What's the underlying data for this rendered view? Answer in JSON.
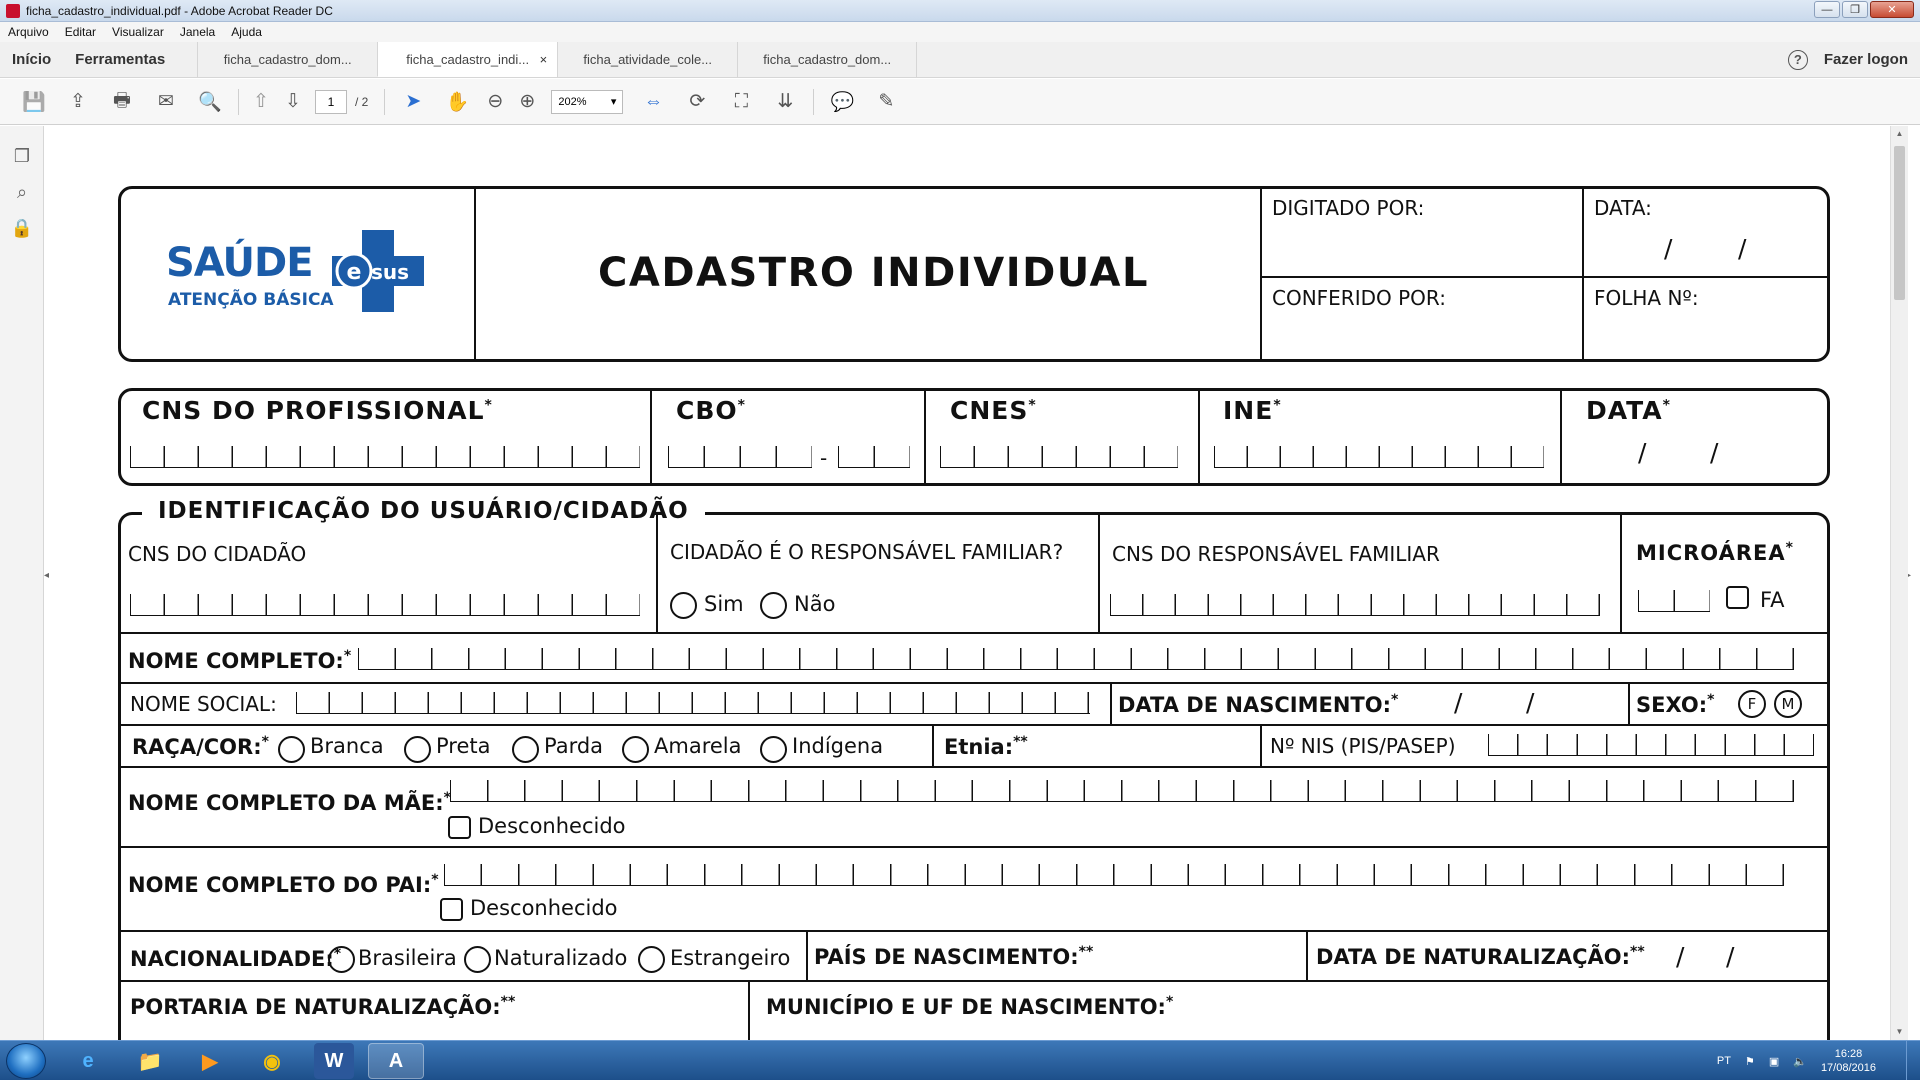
{
  "window": {
    "title": "ficha_cadastro_individual.pdf - Adobe Acrobat Reader DC",
    "minimize": "—",
    "restore": "❐",
    "close": "✕"
  },
  "menu": [
    "Arquivo",
    "Editar",
    "Visualizar",
    "Janela",
    "Ajuda"
  ],
  "tabs": {
    "home": "Início",
    "tools": "Ferramentas",
    "docs": [
      "ficha_cadastro_dom...",
      "ficha_cadastro_indi...",
      "ficha_atividade_cole...",
      "ficha_cadastro_dom..."
    ],
    "close_glyph": "×",
    "help": "?",
    "logon": "Fazer logon"
  },
  "toolbar": {
    "icons": {
      "save": "💾",
      "upload": "⇪",
      "print": "🖶",
      "mail": "✉",
      "search": "🔍",
      "prev": "⇧",
      "next": "⇩",
      "select": "➤",
      "hand": "✋",
      "zoomout": "⊖",
      "zoomin": "⊕",
      "fit": "⇔",
      "rotate": "⟳",
      "fullscreen": "⛶",
      "scroll": "⇊",
      "comment": "💬",
      "sign": "✎"
    },
    "page_current": "1",
    "page_total": "/ 2",
    "zoom": "202%",
    "zoom_arrow": "▾"
  },
  "rail": {
    "pages": "❐",
    "attach": "⌕",
    "security": "🔒",
    "collapse": "◂",
    "expand": "▸"
  },
  "form": {
    "logo_main": "SAÚDE",
    "logo_sus": "sus",
    "logo_sub": "ATENÇÃO BÁSICA",
    "title": "CADASTRO INDIVIDUAL",
    "digitado": "DIGITADO POR:",
    "data_top": "DATA:",
    "conferido": "CONFERIDO POR:",
    "folha": "FOLHA Nº:",
    "slash": "/",
    "star": "*",
    "star2": "**",
    "dash": "-",
    "cns_prof": "CNS DO PROFISSIONAL",
    "cbo": "CBO",
    "cnes": "CNES",
    "ine": "INE",
    "data": "DATA",
    "section": "IDENTIFICAÇÃO DO USUÁRIO/CIDADÃO",
    "cns_cidadao": "CNS DO CIDADÃO",
    "resp_familiar_q": "CIDADÃO É O RESPONSÁVEL FAMILIAR?",
    "sim": "Sim",
    "nao": "Não",
    "cns_resp": "CNS DO RESPONSÁVEL FAMILIAR",
    "microarea": "MICROÁREA",
    "fa": "FA",
    "nome_completo": "NOME COMPLETO:",
    "nome_social": "NOME SOCIAL:",
    "data_nasc": "DATA DE NASCIMENTO:",
    "sexo": "SEXO:",
    "sexo_f": "F",
    "sexo_m": "M",
    "raca": "RAÇA/COR:",
    "racas": [
      "Branca",
      "Preta",
      "Parda",
      "Amarela",
      "Indígena"
    ],
    "etnia": "Etnia:",
    "nis": "Nº NIS (PIS/PASEP)",
    "nome_mae": "NOME COMPLETO DA MÃE:",
    "nome_pai": "NOME COMPLETO DO PAI:",
    "desconhecido": "Desconhecido",
    "nacionalidade": "NACIONALIDADE:",
    "nacionalidades": [
      "Brasileira",
      "Naturalizado",
      "Estrangeiro"
    ],
    "pais_nasc": "PAÍS DE NASCIMENTO:",
    "data_nat": "DATA DE NATURALIZAÇÃO:",
    "portaria": "PORTARIA DE NATURALIZAÇÃO:",
    "municipio": "MUNICÍPIO E UF DE NASCIMENTO:"
  },
  "taskbar": {
    "apps": [
      "e",
      "📁",
      "▶",
      "◉",
      "W",
      "A"
    ],
    "lang": "PT",
    "time": "16:28",
    "date": "17/08/2016"
  },
  "colors": {
    "logo_blue": "#1c5ca8",
    "accent": "#2b6fd1",
    "taskbar": "#1d4f8a"
  }
}
